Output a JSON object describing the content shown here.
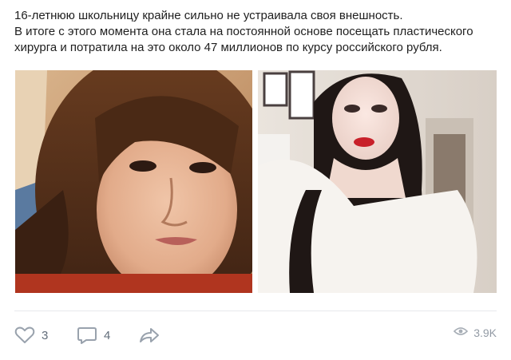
{
  "post": {
    "text_lines": [
      "16-летнюю школьницу крайне сильно не устраивала своя внешность.",
      "В итоге с этого момента она стала на постоянной основе посещать пластического",
      "хирурга и потратила на это около 47 миллионов по курсу российского рубля."
    ]
  },
  "actions": {
    "likes": "3",
    "comments": "4",
    "views": "3.9K"
  },
  "icons": {
    "like": "heart-icon",
    "comment": "comment-icon",
    "share": "share-icon",
    "views": "eye-icon"
  },
  "colors": {
    "icon_gray": "#99a2ad",
    "text_gray": "#626d7a",
    "divider": "#e7e8ec"
  }
}
